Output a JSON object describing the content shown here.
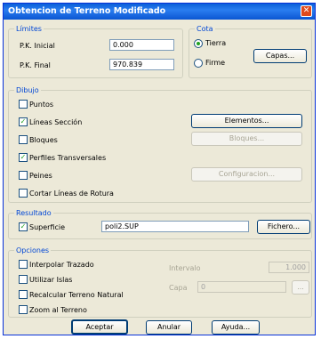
{
  "window": {
    "title": "Obtencion de Terreno Modificado"
  },
  "limites": {
    "legend": "Límites",
    "pk_inicial_label": "P.K. Inicial",
    "pk_inicial_value": "0.000",
    "pk_final_label": "P.K. Final",
    "pk_final_value": "970.839"
  },
  "cota": {
    "legend": "Cota",
    "tierra_label": "Tierra",
    "tierra_selected": true,
    "firme_label": "Firme",
    "firme_selected": false,
    "capas_button": "Capas..."
  },
  "dibujo": {
    "legend": "Dibujo",
    "items": [
      {
        "label": "Puntos",
        "checked": false
      },
      {
        "label": "Líneas Sección",
        "checked": true
      },
      {
        "label": "Bloques",
        "checked": false
      },
      {
        "label": "Perfiles Transversales",
        "checked": true
      },
      {
        "label": "Peines",
        "checked": false
      },
      {
        "label": "Cortar Líneas de Rotura",
        "checked": false
      }
    ],
    "elementos_button": "Elementos...",
    "bloques_button": "Bloques...",
    "configuracion_button": "Configuracion..."
  },
  "resultado": {
    "legend": "Resultado",
    "superficie_label": "Superficie",
    "superficie_checked": true,
    "superficie_value": "poli2.SUP",
    "fichero_button": "Fichero..."
  },
  "opciones": {
    "legend": "Opciones",
    "items": [
      {
        "label": "Interpolar Trazado",
        "checked": false
      },
      {
        "label": "Utilizar Islas",
        "checked": false
      },
      {
        "label": "Recalcular Terreno Natural",
        "checked": false
      },
      {
        "label": "Zoom al Terreno",
        "checked": false
      }
    ],
    "intervalo_label": "Intervalo",
    "intervalo_value": "1.000",
    "capa_label": "Capa",
    "capa_value": "0",
    "capa_browse": "..."
  },
  "footer": {
    "aceptar": "Aceptar",
    "anular": "Anular",
    "ayuda": "Ayuda..."
  }
}
